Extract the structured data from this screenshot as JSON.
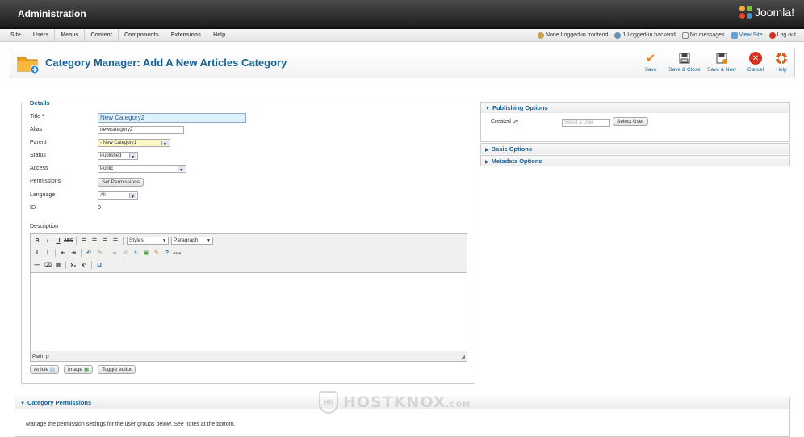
{
  "header": {
    "title": "Administration",
    "logo_text": "Joomla!",
    "colors": {
      "topbar": "#2a2a2a",
      "accent": "#146295"
    }
  },
  "menu": {
    "items": [
      "Site",
      "Users",
      "Menus",
      "Content",
      "Components",
      "Extensions",
      "Help"
    ],
    "status": {
      "frontend": "None Logged-in frontend",
      "backend": "1 Logged-in backend",
      "messages": "No messages",
      "view_site": "View Site",
      "logout": "Log out"
    }
  },
  "toolbar": {
    "page_title": "Category Manager: Add A New Articles Category",
    "buttons": {
      "save": "Save",
      "save_close": "Save & Close",
      "save_new": "Save & New",
      "cancel": "Cancel",
      "help": "Help"
    }
  },
  "details": {
    "legend": "Details",
    "title_label": "Title",
    "title_required": "*",
    "title_value": "New Category2",
    "alias_label": "Alias",
    "alias_value": "newcategory2",
    "parent_label": "Parent",
    "parent_value": "- New Category1",
    "status_label": "Status",
    "status_value": "Published",
    "access_label": "Access",
    "access_value": "Public",
    "permissions_label": "Permissions",
    "permissions_button": "Set Permissions",
    "language_label": "Language",
    "language_value": "All",
    "id_label": "ID",
    "id_value": "0",
    "description_label": "Description"
  },
  "editor": {
    "styles": "Styles",
    "format": "Paragraph",
    "path": "Path: p",
    "buttons": {
      "article": "Article",
      "image": "Image",
      "toggle": "Toggle editor"
    }
  },
  "sidebar": {
    "publishing": {
      "title": "Publishing Options",
      "created_by_label": "Created by",
      "user_placeholder": "Select a User",
      "select_user_button": "Select User"
    },
    "basic": "Basic Options",
    "metadata": "Metadata Options"
  },
  "permissions": {
    "title": "Category Permissions",
    "text": "Manage the permission settings for the user groups below. See notes at the bottom."
  },
  "watermark": {
    "mark": "HK",
    "text": "HOSTKNOX",
    "suffix": ".COM"
  }
}
